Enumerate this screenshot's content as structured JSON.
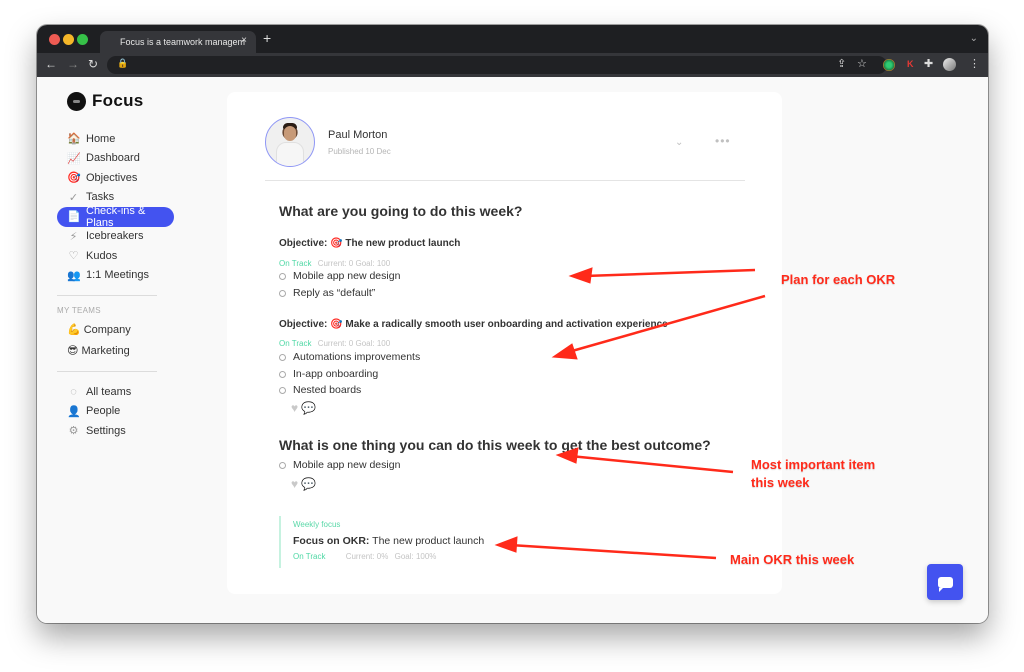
{
  "browser": {
    "tab_title": "Focus is a teamwork managem",
    "close_tab": "×",
    "new_tab": "+",
    "extensions": [
      "share-icon",
      "star-icon",
      "green-extension-icon",
      "k-extension-icon",
      "puzzle-icon",
      "profile-avatar",
      "kebab-menu-icon"
    ],
    "k_extension_label": "K"
  },
  "sidebar": {
    "logo_text": "Focus",
    "items": [
      {
        "label": "Home",
        "icon": "🏠"
      },
      {
        "label": "Dashboard",
        "icon": "📈"
      },
      {
        "label": "Objectives",
        "icon": "🎯"
      },
      {
        "label": "Tasks",
        "icon": "✓"
      },
      {
        "label": "Check-ins & Plans",
        "icon": "📄",
        "active": true
      },
      {
        "label": "Icebreakers",
        "icon": "⚡"
      },
      {
        "label": "Kudos",
        "icon": "♡"
      },
      {
        "label": "1:1 Meetings",
        "icon": "👥"
      }
    ],
    "teams_label": "MY TEAMS",
    "teams": [
      {
        "label": "Company",
        "emoji": "💪"
      },
      {
        "label": "Marketing",
        "emoji": "😎"
      }
    ],
    "bottom_items": [
      {
        "label": "All teams",
        "icon": "◌"
      },
      {
        "label": "People",
        "icon": "👤"
      },
      {
        "label": "Settings",
        "icon": "⚙"
      }
    ]
  },
  "post": {
    "author": "Paul Morton",
    "published": "Published 10 Dec",
    "chevron": "⌄",
    "more": "•••",
    "question1": "What are you going to do this week?",
    "objectives": [
      {
        "prefix": "Objective:",
        "title": "The new product launch",
        "status": "On Track",
        "current": "Current: 0",
        "goal": "Goal: 100",
        "tasks": [
          "Mobile app new design",
          "Reply as “default”"
        ]
      },
      {
        "prefix": "Objective:",
        "title": "Make a radically smooth user onboarding and activation experience",
        "status": "On Track",
        "current": "Current: 0",
        "goal": "Goal: 100",
        "tasks": [
          "Automations improvements",
          "In-app onboarding",
          "Nested boards"
        ]
      }
    ],
    "question2": "What is one thing you can do this week to get the best outcome?",
    "important_task": "Mobile app new design",
    "weekly_focus": {
      "label": "Weekly focus",
      "prefix": "Focus on OKR:",
      "title": "The new product launch",
      "status": "On Track",
      "current": "Current: 0%",
      "goal": "Goal: 100%"
    }
  },
  "annotations": {
    "plan": "Plan for each OKR",
    "important_line1": "Most important item",
    "important_line2": "this week",
    "main_okr": "Main OKR this week"
  },
  "colors": {
    "accent": "#4353f0",
    "on_track": "#4fd8a5",
    "annotation": "#ff2a1a"
  }
}
